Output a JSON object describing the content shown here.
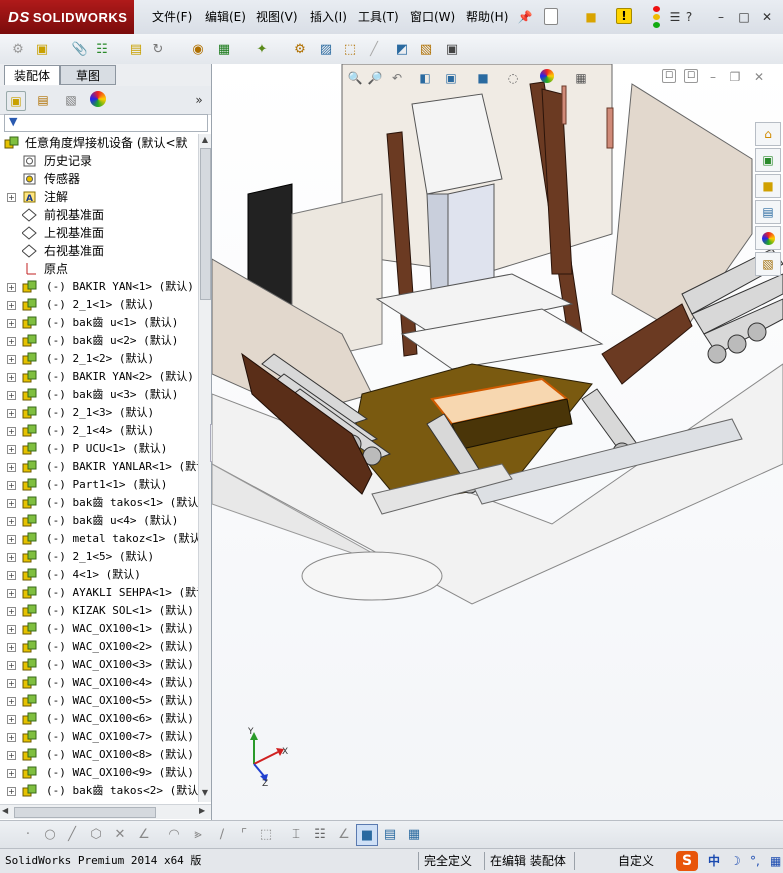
{
  "app": {
    "logo_mark": "DS",
    "logo_text": "SOLIDWORKS"
  },
  "menu": [
    "文件(F)",
    "编辑(E)",
    "视图(V)",
    "插入(I)",
    "工具(T)",
    "窗口(W)",
    "帮助(H)"
  ],
  "panel_tabs": [
    "装配体",
    "草图"
  ],
  "tree": {
    "root": "任意角度焊接机设备  (默认<默",
    "features": [
      "历史记录",
      "传感器",
      "注解",
      "前视基准面",
      "上视基准面",
      "右视基准面",
      "原点"
    ],
    "components": [
      "(-) BAKIR YAN<1> (默认)",
      "(-) 2_1<1> (默认)",
      "(-) bak齒 u<1> (默认)",
      "(-) bak齒 u<2> (默认)",
      "(-) 2_1<2> (默认)",
      "(-) BAKIR YAN<2> (默认)",
      "(-) bak齒 u<3> (默认)",
      "(-) 2_1<3> (默认)",
      "(-) 2_1<4> (默认)",
      "(-) P UCU<1> (默认)",
      "(-) BAKIR YANLAR<1> (默认",
      "(-) Part1<1> (默认)",
      "(-) bak齒 takos<1> (默认)",
      "(-) bak齒 u<4> (默认)",
      "(-) metal takoz<1> (默认)",
      "(-) 2_1<5> (默认)",
      "(-) 4<1> (默认)",
      "(-) AYAKLI SEHPA<1> (默认",
      "(-) KIZAK SOL<1> (默认)",
      "(-) WAC_OX100<1> (默认)",
      "(-) WAC_OX100<2> (默认)",
      "(-) WAC_OX100<3> (默认)",
      "(-) WAC_OX100<4> (默认)",
      "(-) WAC_OX100<5> (默认)",
      "(-) WAC_OX100<6> (默认)",
      "(-) WAC_OX100<7> (默认)",
      "(-) WAC_OX100<8> (默认)",
      "(-) WAC_OX100<9> (默认)",
      "(-) bak齒 takos<2> (默认)"
    ]
  },
  "triad": {
    "x": "X",
    "y": "Y",
    "z": "Z"
  },
  "status": {
    "product": "SolidWorks Premium 2014 x64 版",
    "definition": "完全定义",
    "mode": "在编辑 装配体",
    "units": "自定义"
  },
  "ime": {
    "label": "中"
  },
  "colors": {
    "brand_red": "#9e1414",
    "frame_brown": "#6b3a22",
    "base_gold": "#7a5a10",
    "part_gray": "#d8d8d8"
  }
}
